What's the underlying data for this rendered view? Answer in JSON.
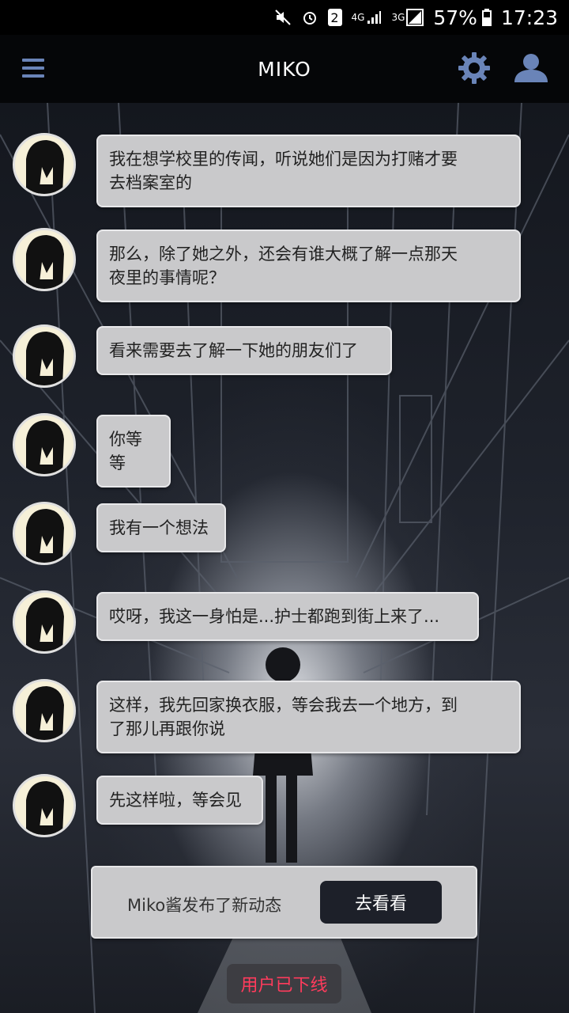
{
  "status_bar": {
    "sim_badge": "2",
    "net1": "4G",
    "net2": "3G",
    "battery": "57%",
    "time": "17:23"
  },
  "header": {
    "title": "MIKO",
    "menu_icon": "hamburger-menu-icon",
    "settings_icon": "gear-icon",
    "profile_icon": "user-icon"
  },
  "messages": [
    {
      "lines": [
        "我在想学校里的传闻，听说她们是因为打赌才要",
        "去档案室的"
      ]
    },
    {
      "lines": [
        "那么，除了她之外，还会有谁大概了解一点那天",
        "夜里的事情呢？"
      ]
    },
    {
      "lines": [
        "看来需要去了解一下她的朋友们了"
      ]
    },
    {
      "lines": [
        "你等等"
      ]
    },
    {
      "lines": [
        "我有一个想法"
      ]
    },
    {
      "lines": [
        "哎呀，我这一身怕是...护士都跑到街上来了..."
      ]
    },
    {
      "lines": [
        "这样，我先回家换衣服，等会我去一个地方，到",
        "了那儿再跟你说"
      ]
    },
    {
      "lines": [
        "先这样啦，等会见"
      ]
    }
  ],
  "notice": {
    "text": "Miko酱发布了新动态",
    "button": "去看看"
  },
  "offline_status": "用户已下线",
  "colors": {
    "bubble": "#c9c9cb",
    "accent_icons": "#6a84b8",
    "offline_text": "#ff3b5c"
  }
}
